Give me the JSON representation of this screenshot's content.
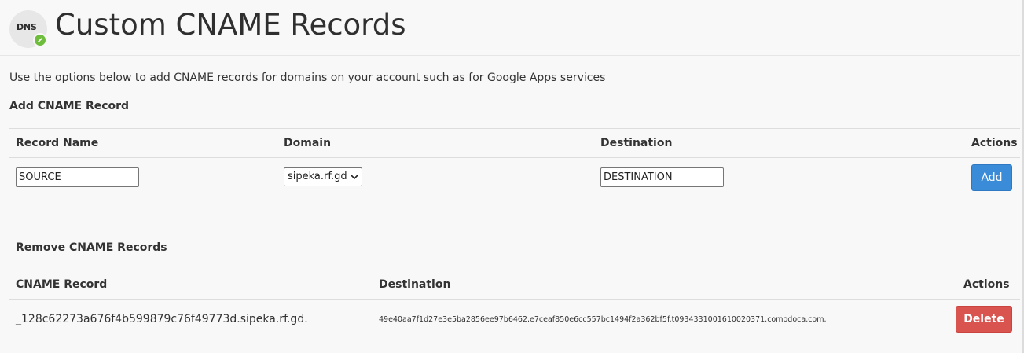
{
  "header": {
    "icon_text": "DNS",
    "icon_name": "dns-edit-icon",
    "title": "Custom CNAME Records"
  },
  "intro_text": "Use the options below to add CNAME records for domains on your account such as for Google Apps services",
  "add_section": {
    "title": "Add CNAME Record",
    "columns": {
      "record_name": "Record Name",
      "domain": "Domain",
      "destination": "Destination",
      "actions": "Actions"
    },
    "record_name_value": "SOURCE",
    "domain_selected": "sipeka.rf.gd",
    "destination_value": "DESTINATION",
    "add_label": "Add"
  },
  "remove_section": {
    "title": "Remove CNAME Records",
    "columns": {
      "cname_record": "CNAME Record",
      "destination": "Destination",
      "actions": "Actions"
    },
    "rows": [
      {
        "cname_record": "_128c62273a676f4b599879c76f49773d.sipeka.rf.gd.",
        "destination": "49e40aa7f1d27e3e5ba2856ee97b6462.e7ceaf850e6cc557bc1494f2a362bf5f.t0934331001610020371.comodoca.com.",
        "delete_label": "Delete"
      }
    ]
  },
  "colors": {
    "add_button": "#3a8bd8",
    "delete_button": "#d9534f",
    "dns_badge": "#6ebd3d"
  }
}
